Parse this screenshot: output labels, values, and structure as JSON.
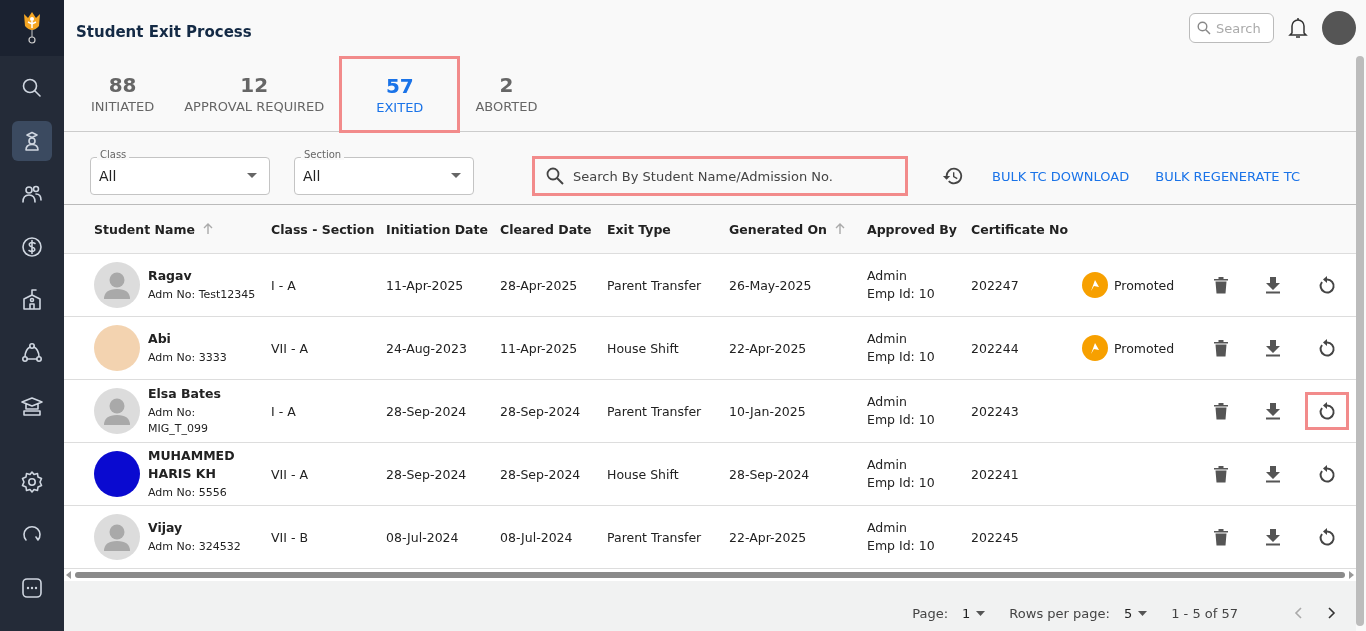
{
  "sidebar": {
    "items": [
      {
        "selected": false
      },
      {
        "selected": true
      },
      {
        "selected": false
      },
      {
        "selected": false
      },
      {
        "selected": false
      },
      {
        "selected": false
      },
      {
        "selected": false
      },
      {
        "selected": false
      },
      {
        "selected": false
      },
      {
        "selected": false
      }
    ]
  },
  "header": {
    "title": "Student Exit Process",
    "search": {
      "placeholder": "Search"
    }
  },
  "tabs": [
    {
      "count": "88",
      "label": "INITIATED",
      "selected": false,
      "highlighted": false
    },
    {
      "count": "12",
      "label": "APPROVAL REQUIRED",
      "selected": false,
      "highlighted": false
    },
    {
      "count": "57",
      "label": "EXITED",
      "selected": true,
      "highlighted": true
    },
    {
      "count": "2",
      "label": "ABORTED",
      "selected": false,
      "highlighted": false
    }
  ],
  "filters": [
    {
      "label": "Class",
      "value": "All"
    },
    {
      "label": "Section",
      "value": "All"
    }
  ],
  "search": {
    "placeholder": "Search By Student Name/Admission No.",
    "highlighted": true
  },
  "actions": [
    "BULK TC DOWNLOAD",
    "BULK REGENERATE TC"
  ],
  "table": {
    "columns": [
      {
        "label": "Student Name",
        "sortable": true
      },
      {
        "label": "Class - Section",
        "sortable": false
      },
      {
        "label": "Initiation Date",
        "sortable": false
      },
      {
        "label": "Cleared Date",
        "sortable": false
      },
      {
        "label": "Exit Type",
        "sortable": false
      },
      {
        "label": "Generated On",
        "sortable": true
      },
      {
        "label": "Approved By",
        "sortable": false
      },
      {
        "label": "Certificate No",
        "sortable": false
      }
    ],
    "rows": [
      {
        "avatar": {
          "kind": "placeholder"
        },
        "name": "Ragav",
        "adm": "Adm No: Test12345",
        "class": "I - A",
        "initiation": "11-Apr-2025",
        "cleared": "28-Apr-2025",
        "exit_type": "Parent Transfer",
        "generated": "26-May-2025",
        "approver": "Admin",
        "emp": "Emp Id: 10",
        "certificate": "202247",
        "status": "Promoted",
        "regenerate_highlighted": false
      },
      {
        "avatar": {
          "kind": "picture",
          "color": "#f3d3b0"
        },
        "name": "Abi",
        "adm": "Adm No: 3333",
        "class": "VII - A",
        "initiation": "24-Aug-2023",
        "cleared": "11-Apr-2025",
        "exit_type": "House Shift",
        "generated": "22-Apr-2025",
        "approver": "Admin",
        "emp": "Emp Id: 10",
        "certificate": "202244",
        "status": "Promoted",
        "regenerate_highlighted": false
      },
      {
        "avatar": {
          "kind": "placeholder"
        },
        "name": "Elsa Bates",
        "adm": "Adm No:\nMIG_T_099",
        "class": "I - A",
        "initiation": "28-Sep-2024",
        "cleared": "28-Sep-2024",
        "exit_type": "Parent Transfer",
        "generated": "10-Jan-2025",
        "approver": "Admin",
        "emp": "Emp Id: 10",
        "certificate": "202243",
        "regenerate_highlighted": true
      },
      {
        "avatar": {
          "kind": "picture",
          "color": "#0a0ad0"
        },
        "name": "MUHAMMED\nHARIS KH",
        "adm": "Adm No: 5556",
        "class": "VII - A",
        "initiation": "28-Sep-2024",
        "cleared": "28-Sep-2024",
        "exit_type": "House Shift",
        "generated": "28-Sep-2024",
        "approver": "Admin",
        "emp": "Emp Id: 10",
        "certificate": "202241",
        "regenerate_highlighted": false
      },
      {
        "avatar": {
          "kind": "placeholder"
        },
        "name": "Vijay",
        "adm": "Adm No: 324532",
        "class": "VII - B",
        "initiation": "08-Jul-2024",
        "cleared": "08-Jul-2024",
        "exit_type": "Parent Transfer",
        "generated": "22-Apr-2025",
        "approver": "Admin",
        "emp": "Emp Id: 10",
        "certificate": "202245",
        "regenerate_highlighted": false
      }
    ]
  },
  "pagination": {
    "page_label": "Page:",
    "page": "1",
    "rows_label": "Rows per page:",
    "rows": "5",
    "range": "1 - 5 of 57"
  }
}
